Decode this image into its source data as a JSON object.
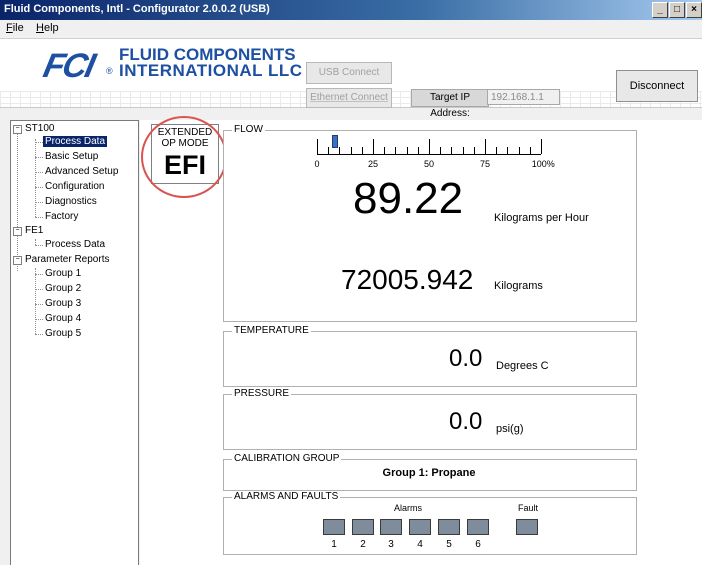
{
  "window": {
    "title": "Fluid Components, Intl - Configurator 2.0.0.2 (USB)",
    "controls": [
      "_",
      "□",
      "×"
    ]
  },
  "menu": {
    "items": [
      "File",
      "Help"
    ]
  },
  "header": {
    "logo_mark": "FCI",
    "logo_line1": "FLUID COMPONENTS",
    "logo_line2": "INTERNATIONAL LLC",
    "logo_reg": "®",
    "usb_connect": "USB Connect",
    "ethernet_connect": "Ethernet Connect",
    "target_ip_label": "Target IP Address:",
    "target_ip_value": "192.168.1.1",
    "disconnect": "Disconnect"
  },
  "tree": {
    "st100": "ST100",
    "st100_items": [
      "Process Data",
      "Basic Setup",
      "Advanced Setup",
      "Configuration",
      "Diagnostics",
      "Factory"
    ],
    "fe1": "FE1",
    "fe1_items": [
      "Process Data"
    ],
    "reports": "Parameter Reports",
    "report_items": [
      "Group 1",
      "Group 2",
      "Group 3",
      "Group 4",
      "Group 5"
    ],
    "expander": "−"
  },
  "mode": {
    "line1": "EXTENDED",
    "line2": "OP MODE",
    "value": "EFI"
  },
  "flow": {
    "legend": "FLOW",
    "scale_labels": [
      "0",
      "25",
      "50",
      "75",
      "100%"
    ],
    "pointer_percent": 8,
    "rate_value": "89.22",
    "rate_unit": "Kilograms per Hour",
    "total_value": "72005.942",
    "total_unit": "Kilograms"
  },
  "temperature": {
    "legend": "TEMPERATURE",
    "value": "0.0",
    "unit": "Degrees C"
  },
  "pressure": {
    "legend": "PRESSURE",
    "value": "0.0",
    "unit": "psi(g)"
  },
  "calibration": {
    "legend": "CALIBRATION GROUP",
    "value": "Group 1: Propane"
  },
  "alarms": {
    "legend": "ALARMS AND FAULTS",
    "alarms_label": "Alarms",
    "fault_label": "Fault",
    "alarm_numbers": [
      "1",
      "2",
      "3",
      "4",
      "5",
      "6"
    ]
  },
  "colors": {
    "selection": "#0a246a",
    "alarm_indicator": "#7f8c9c",
    "highlight_circle": "#d9534f",
    "brand": "#1d4fa3"
  }
}
